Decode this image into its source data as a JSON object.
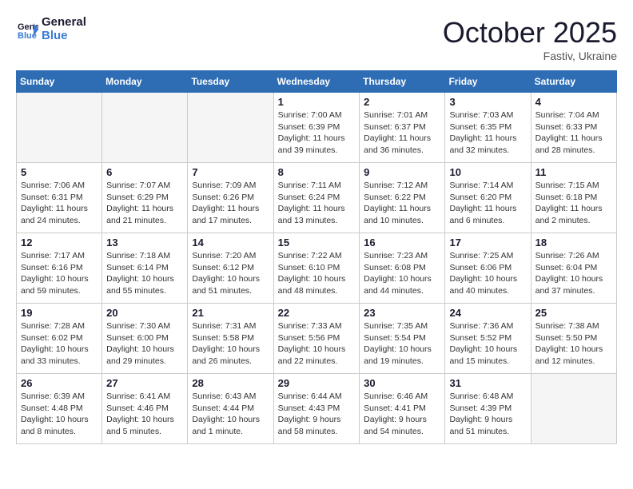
{
  "header": {
    "logo_text_general": "General",
    "logo_text_blue": "Blue",
    "month_year": "October 2025",
    "location": "Fastiv, Ukraine"
  },
  "days_of_week": [
    "Sunday",
    "Monday",
    "Tuesday",
    "Wednesday",
    "Thursday",
    "Friday",
    "Saturday"
  ],
  "weeks": [
    [
      {
        "num": "",
        "info": ""
      },
      {
        "num": "",
        "info": ""
      },
      {
        "num": "",
        "info": ""
      },
      {
        "num": "1",
        "info": "Sunrise: 7:00 AM\nSunset: 6:39 PM\nDaylight: 11 hours\nand 39 minutes."
      },
      {
        "num": "2",
        "info": "Sunrise: 7:01 AM\nSunset: 6:37 PM\nDaylight: 11 hours\nand 36 minutes."
      },
      {
        "num": "3",
        "info": "Sunrise: 7:03 AM\nSunset: 6:35 PM\nDaylight: 11 hours\nand 32 minutes."
      },
      {
        "num": "4",
        "info": "Sunrise: 7:04 AM\nSunset: 6:33 PM\nDaylight: 11 hours\nand 28 minutes."
      }
    ],
    [
      {
        "num": "5",
        "info": "Sunrise: 7:06 AM\nSunset: 6:31 PM\nDaylight: 11 hours\nand 24 minutes."
      },
      {
        "num": "6",
        "info": "Sunrise: 7:07 AM\nSunset: 6:29 PM\nDaylight: 11 hours\nand 21 minutes."
      },
      {
        "num": "7",
        "info": "Sunrise: 7:09 AM\nSunset: 6:26 PM\nDaylight: 11 hours\nand 17 minutes."
      },
      {
        "num": "8",
        "info": "Sunrise: 7:11 AM\nSunset: 6:24 PM\nDaylight: 11 hours\nand 13 minutes."
      },
      {
        "num": "9",
        "info": "Sunrise: 7:12 AM\nSunset: 6:22 PM\nDaylight: 11 hours\nand 10 minutes."
      },
      {
        "num": "10",
        "info": "Sunrise: 7:14 AM\nSunset: 6:20 PM\nDaylight: 11 hours\nand 6 minutes."
      },
      {
        "num": "11",
        "info": "Sunrise: 7:15 AM\nSunset: 6:18 PM\nDaylight: 11 hours\nand 2 minutes."
      }
    ],
    [
      {
        "num": "12",
        "info": "Sunrise: 7:17 AM\nSunset: 6:16 PM\nDaylight: 10 hours\nand 59 minutes."
      },
      {
        "num": "13",
        "info": "Sunrise: 7:18 AM\nSunset: 6:14 PM\nDaylight: 10 hours\nand 55 minutes."
      },
      {
        "num": "14",
        "info": "Sunrise: 7:20 AM\nSunset: 6:12 PM\nDaylight: 10 hours\nand 51 minutes."
      },
      {
        "num": "15",
        "info": "Sunrise: 7:22 AM\nSunset: 6:10 PM\nDaylight: 10 hours\nand 48 minutes."
      },
      {
        "num": "16",
        "info": "Sunrise: 7:23 AM\nSunset: 6:08 PM\nDaylight: 10 hours\nand 44 minutes."
      },
      {
        "num": "17",
        "info": "Sunrise: 7:25 AM\nSunset: 6:06 PM\nDaylight: 10 hours\nand 40 minutes."
      },
      {
        "num": "18",
        "info": "Sunrise: 7:26 AM\nSunset: 6:04 PM\nDaylight: 10 hours\nand 37 minutes."
      }
    ],
    [
      {
        "num": "19",
        "info": "Sunrise: 7:28 AM\nSunset: 6:02 PM\nDaylight: 10 hours\nand 33 minutes."
      },
      {
        "num": "20",
        "info": "Sunrise: 7:30 AM\nSunset: 6:00 PM\nDaylight: 10 hours\nand 29 minutes."
      },
      {
        "num": "21",
        "info": "Sunrise: 7:31 AM\nSunset: 5:58 PM\nDaylight: 10 hours\nand 26 minutes."
      },
      {
        "num": "22",
        "info": "Sunrise: 7:33 AM\nSunset: 5:56 PM\nDaylight: 10 hours\nand 22 minutes."
      },
      {
        "num": "23",
        "info": "Sunrise: 7:35 AM\nSunset: 5:54 PM\nDaylight: 10 hours\nand 19 minutes."
      },
      {
        "num": "24",
        "info": "Sunrise: 7:36 AM\nSunset: 5:52 PM\nDaylight: 10 hours\nand 15 minutes."
      },
      {
        "num": "25",
        "info": "Sunrise: 7:38 AM\nSunset: 5:50 PM\nDaylight: 10 hours\nand 12 minutes."
      }
    ],
    [
      {
        "num": "26",
        "info": "Sunrise: 6:39 AM\nSunset: 4:48 PM\nDaylight: 10 hours\nand 8 minutes."
      },
      {
        "num": "27",
        "info": "Sunrise: 6:41 AM\nSunset: 4:46 PM\nDaylight: 10 hours\nand 5 minutes."
      },
      {
        "num": "28",
        "info": "Sunrise: 6:43 AM\nSunset: 4:44 PM\nDaylight: 10 hours\nand 1 minute."
      },
      {
        "num": "29",
        "info": "Sunrise: 6:44 AM\nSunset: 4:43 PM\nDaylight: 9 hours\nand 58 minutes."
      },
      {
        "num": "30",
        "info": "Sunrise: 6:46 AM\nSunset: 4:41 PM\nDaylight: 9 hours\nand 54 minutes."
      },
      {
        "num": "31",
        "info": "Sunrise: 6:48 AM\nSunset: 4:39 PM\nDaylight: 9 hours\nand 51 minutes."
      },
      {
        "num": "",
        "info": ""
      }
    ]
  ]
}
